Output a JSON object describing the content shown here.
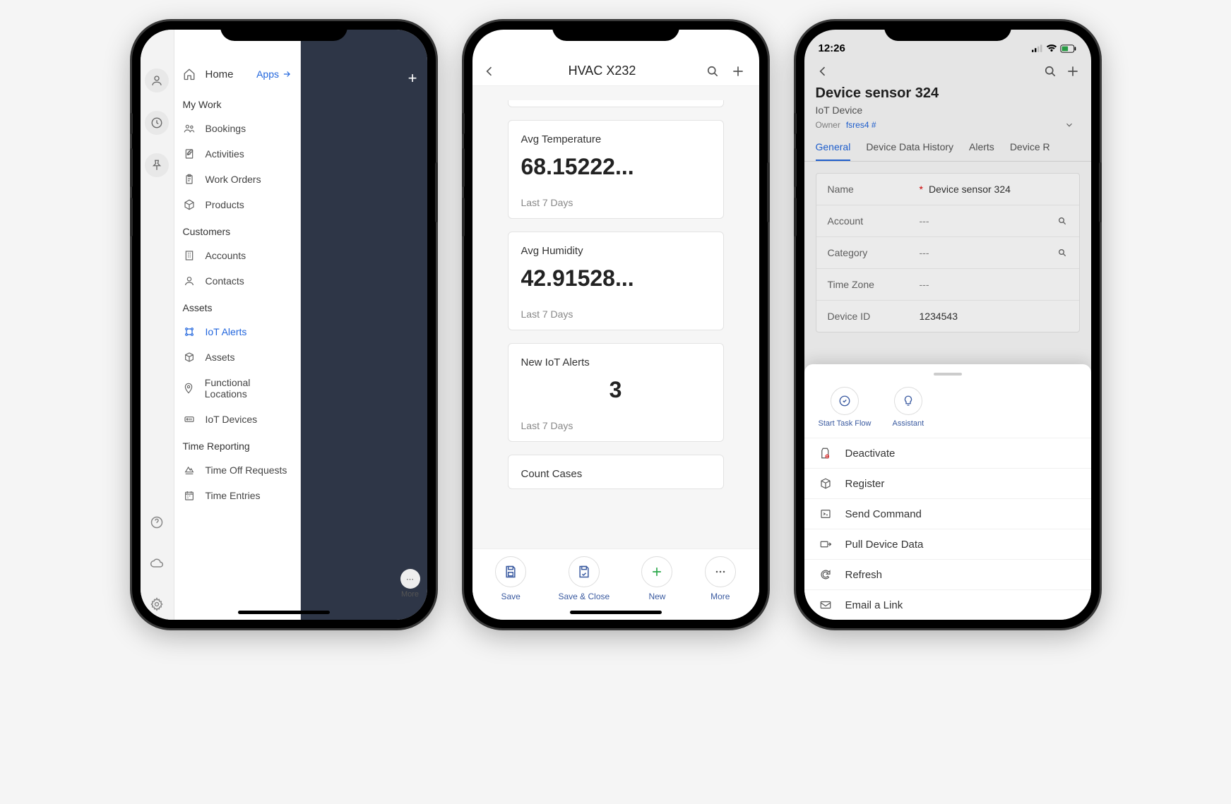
{
  "phone1": {
    "home_label": "Home",
    "apps_link": "Apps",
    "sections": {
      "my_work": {
        "header": "My Work",
        "items": [
          {
            "label": "Bookings",
            "icon": "people-icon"
          },
          {
            "label": "Activities",
            "icon": "note-icon"
          },
          {
            "label": "Work Orders",
            "icon": "clipboard-icon"
          },
          {
            "label": "Products",
            "icon": "package-icon"
          }
        ]
      },
      "customers": {
        "header": "Customers",
        "items": [
          {
            "label": "Accounts",
            "icon": "building-icon"
          },
          {
            "label": "Contacts",
            "icon": "person-icon"
          }
        ]
      },
      "assets": {
        "header": "Assets",
        "items": [
          {
            "label": "IoT Alerts",
            "icon": "iot-alert-icon",
            "active": true
          },
          {
            "label": "Assets",
            "icon": "asset-icon"
          },
          {
            "label": "Functional Locations",
            "icon": "location-icon"
          },
          {
            "label": "IoT Devices",
            "icon": "device-icon"
          }
        ]
      },
      "time_reporting": {
        "header": "Time Reporting",
        "items": [
          {
            "label": "Time Off Requests",
            "icon": "timeoff-icon"
          },
          {
            "label": "Time Entries",
            "icon": "calendar-icon"
          }
        ]
      }
    },
    "backdrop_more": "More"
  },
  "phone2": {
    "title": "HVAC X232",
    "cards": [
      {
        "label": "Avg Temperature",
        "value": "68.15222...",
        "period": "Last 7 Days"
      },
      {
        "label": "Avg Humidity",
        "value": "42.91528...",
        "period": "Last 7 Days"
      },
      {
        "label": "New IoT Alerts",
        "value": "3",
        "period": "Last 7 Days",
        "center": true
      },
      {
        "label": "Count Cases"
      }
    ],
    "toolbar": {
      "save": "Save",
      "save_close": "Save & Close",
      "new": "New",
      "more": "More"
    }
  },
  "phone3": {
    "status_time": "12:26",
    "title": "Device sensor 324",
    "subtitle": "IoT Device",
    "owner_label": "Owner",
    "owner_value": "fsres4 #",
    "tabs": [
      "General",
      "Device Data History",
      "Alerts",
      "Device R"
    ],
    "fields": {
      "name": {
        "label": "Name",
        "value": "Device sensor 324",
        "required": true
      },
      "account": {
        "label": "Account",
        "value": "---",
        "lookup": true
      },
      "category": {
        "label": "Category",
        "value": "---",
        "lookup": true
      },
      "timezone": {
        "label": "Time Zone",
        "value": "---"
      },
      "device_id": {
        "label": "Device ID",
        "value": "1234543"
      }
    },
    "quick": {
      "task_flow": "Start Task Flow",
      "assistant": "Assistant"
    },
    "actions": [
      {
        "label": "Deactivate",
        "icon": "deactivate-icon"
      },
      {
        "label": "Register",
        "icon": "register-icon"
      },
      {
        "label": "Send Command",
        "icon": "command-icon"
      },
      {
        "label": "Pull Device Data",
        "icon": "pull-icon"
      },
      {
        "label": "Refresh",
        "icon": "refresh-icon"
      },
      {
        "label": "Email a Link",
        "icon": "email-icon"
      }
    ]
  }
}
